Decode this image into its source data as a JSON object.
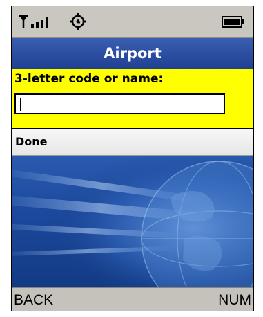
{
  "status_bar": {
    "signal_icon": "signal-strength-icon",
    "gear_icon": "settings-gear-icon",
    "battery_icon": "battery-full-icon"
  },
  "header": {
    "title": "Airport"
  },
  "form": {
    "label": "3-letter code or name:",
    "input_value": ""
  },
  "menu": {
    "done_label": "Done"
  },
  "softkeys": {
    "left_label": "BACK",
    "right_label": "NUM"
  },
  "colors": {
    "form_background": "#ffff00",
    "title_bar": "#2a4ea3",
    "wallpaper": "#1d4a9e"
  }
}
